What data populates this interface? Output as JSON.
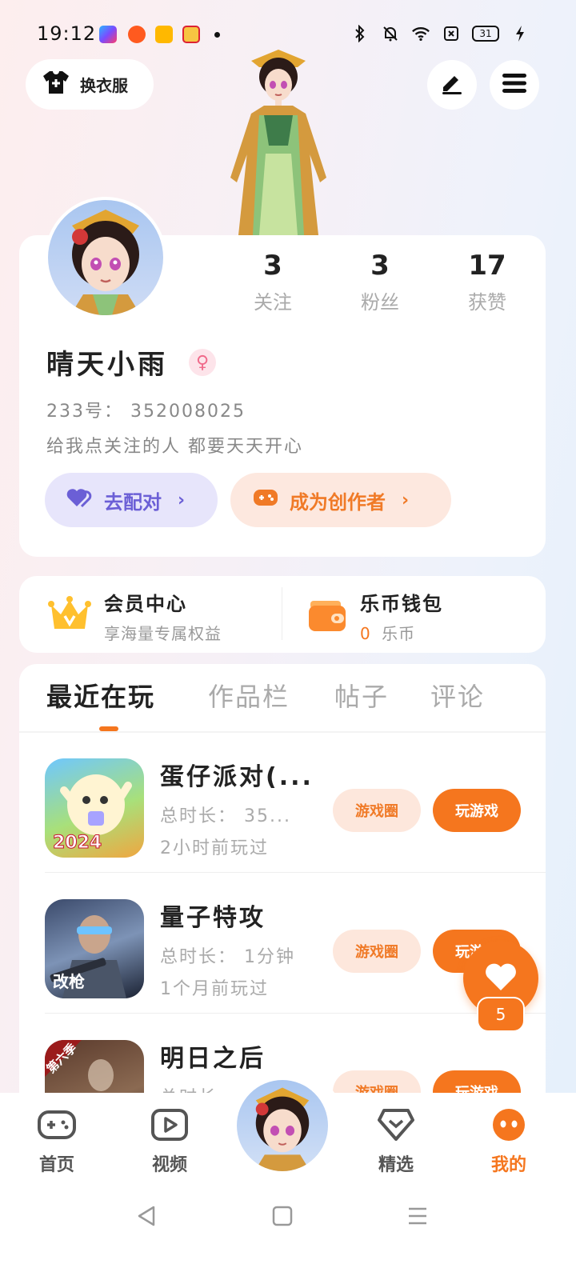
{
  "status_bar": {
    "time": "19:12",
    "battery": "31"
  },
  "header": {
    "change_outfit_label": "换衣服"
  },
  "profile": {
    "stats": [
      {
        "value": "3",
        "label": "关注"
      },
      {
        "value": "3",
        "label": "粉丝"
      },
      {
        "value": "17",
        "label": "获赞"
      }
    ],
    "username": "晴天小雨",
    "gender_symbol": "♀",
    "user_id": "233号：  352008025",
    "bio": "给我点关注的人 都要天天开心",
    "match_label": "去配对",
    "creator_label": "成为创作者"
  },
  "vip": {
    "member_title": "会员中心",
    "member_sub": "享海量专属权益",
    "wallet_title": "乐币钱包",
    "wallet_amount": "0",
    "wallet_unit": "乐币"
  },
  "tabs": [
    "最近在玩",
    "作品栏",
    "帖子",
    "评论"
  ],
  "games": [
    {
      "name": "蛋仔派对(...",
      "duration": "总时长：  35...",
      "last_played": "2小时前玩过",
      "circle_label": "游戏圈",
      "play_label": "玩游戏",
      "icon_badge": "2024"
    },
    {
      "name": "量子特攻",
      "duration": "总时长：  1分钟",
      "last_played": "1个月前玩过",
      "circle_label": "游戏圈",
      "play_label": "玩游戏",
      "icon_badge": "改枪"
    },
    {
      "name": "明日之后",
      "duration": "总时长",
      "last_played": "",
      "circle_label": "游戏圈",
      "play_label": "玩游戏",
      "icon_badge": "第六季"
    }
  ],
  "like_fab": {
    "count": "5"
  },
  "bottom_nav": [
    {
      "label": "首页"
    },
    {
      "label": "视频"
    },
    {
      "label": "精选"
    },
    {
      "label": "我的"
    }
  ],
  "colors": {
    "accent": "#f5761e",
    "match_purple": "#6b5fd6",
    "gender_pink": "#f06b8b"
  }
}
